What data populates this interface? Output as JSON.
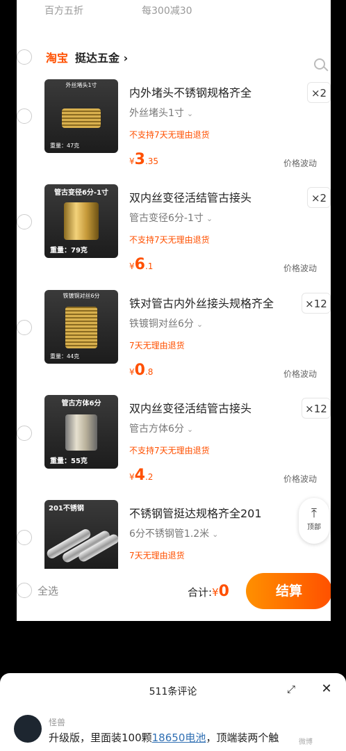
{
  "top_partial": {
    "left": "百方五折",
    "right": "每300减30"
  },
  "store": {
    "platform_label": "淘宝",
    "name": "挺达五金 ›"
  },
  "items": [
    {
      "thumb_caption": "外丝堵头1寸",
      "thumb_weight": "重量：47克",
      "title": "内外堵头不锈钢规格齐全",
      "spec": "外丝堵头1寸",
      "policy": "不支持7天无理由退货",
      "currency": "¥",
      "price_int": "3",
      "price_dec": ".35",
      "fluctuation": "价格波动",
      "qty": "×2"
    },
    {
      "thumb_caption": "管古变径6分-1寸",
      "thumb_weight": "重量：79克",
      "title": "双内丝变径活结管古接头",
      "spec": "管古变径6分-1寸",
      "policy": "不支持7天无理由退货",
      "currency": "¥",
      "price_int": "6",
      "price_dec": ".1",
      "fluctuation": "价格波动",
      "qty": "×2"
    },
    {
      "thumb_caption": "铁镀铜对丝6分",
      "thumb_weight": "重量：44克",
      "title": "铁对管古内外丝接头规格齐全",
      "spec": "铁镀铜对丝6分",
      "policy": "7天无理由退货",
      "currency": "¥",
      "price_int": "0",
      "price_dec": ".8",
      "fluctuation": "价格波动",
      "qty": "×12"
    },
    {
      "thumb_caption": "管古方体6分",
      "thumb_weight": "重量：55克",
      "title": "双内丝变径活结管古接头",
      "spec": "管古方体6分",
      "policy": "不支持7天无理由退货",
      "currency": "¥",
      "price_int": "4",
      "price_dec": ".2",
      "fluctuation": "价格波动",
      "qty": "×12"
    },
    {
      "thumb_caption": "201不锈钢",
      "thumb_weight": "",
      "title": "不锈钢管挺达规格齐全201",
      "spec": "6分不锈钢管1.2米",
      "policy": "7天无理由退货",
      "currency": "",
      "price_int": "",
      "price_dec": "",
      "fluctuation": "",
      "qty": ""
    }
  ],
  "to_top_label": "顶部",
  "footer": {
    "select_all": "全选",
    "total_label": "合计:",
    "total_currency": "¥",
    "total_amount": "0",
    "checkout": "结算"
  },
  "comments": {
    "count": "511条评论",
    "username": "怪兽",
    "text_before": "升级版，里面装100颗",
    "link_text": "18650电池",
    "text_after": "，顶端装两个触"
  },
  "watermark": "微博"
}
